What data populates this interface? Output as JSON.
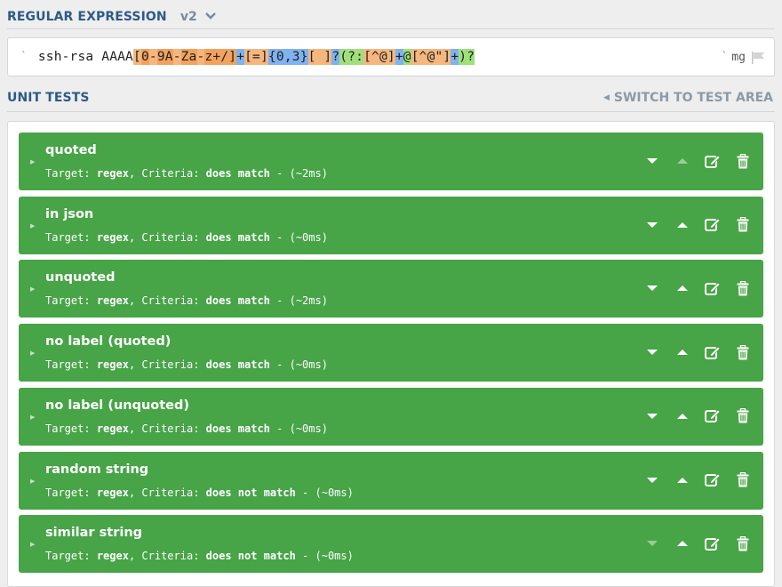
{
  "regex_section": {
    "title": "REGULAR EXPRESSION",
    "version": "v2",
    "open_delimiter": "`",
    "close_delimiter": "`",
    "flags": "mg",
    "tokens": [
      {
        "text": "ssh-rsa AAAA",
        "kind": "plain"
      },
      {
        "text": "[",
        "kind": "set"
      },
      {
        "text": "0",
        "kind": "setop"
      },
      {
        "text": "-",
        "kind": "set"
      },
      {
        "text": "9A",
        "kind": "setop"
      },
      {
        "text": "-",
        "kind": "set"
      },
      {
        "text": "Za",
        "kind": "setop"
      },
      {
        "text": "-",
        "kind": "set"
      },
      {
        "text": "z+/]",
        "kind": "setop"
      },
      {
        "text": "+",
        "kind": "quant"
      },
      {
        "text": "[=]",
        "kind": "set"
      },
      {
        "text": "{0,3}",
        "kind": "quant"
      },
      {
        "text": "[ ]",
        "kind": "set"
      },
      {
        "text": "?",
        "kind": "quant"
      },
      {
        "text": "(?:",
        "kind": "grp"
      },
      {
        "text": "[^@]",
        "kind": "set"
      },
      {
        "text": "+",
        "kind": "quant"
      },
      {
        "text": "@",
        "kind": "grp"
      },
      {
        "text": "[^@\"]",
        "kind": "set"
      },
      {
        "text": "+",
        "kind": "quant"
      },
      {
        "text": ")?",
        "kind": "grp"
      }
    ]
  },
  "tests_section": {
    "title": "UNIT TESTS",
    "switch_label": "SWITCH TO TEST AREA"
  },
  "tests": [
    {
      "name": "quoted",
      "target_label": "Target:",
      "target": "regex",
      "criteria_label": "Criteria:",
      "criteria": "does match",
      "time": "- (~2ms)",
      "down_enabled": true,
      "up_enabled": false
    },
    {
      "name": "in json",
      "target_label": "Target:",
      "target": "regex",
      "criteria_label": "Criteria:",
      "criteria": "does match",
      "time": "- (~0ms)",
      "down_enabled": true,
      "up_enabled": true
    },
    {
      "name": "unquoted",
      "target_label": "Target:",
      "target": "regex",
      "criteria_label": "Criteria:",
      "criteria": "does match",
      "time": "- (~2ms)",
      "down_enabled": true,
      "up_enabled": true
    },
    {
      "name": "no label (quoted)",
      "target_label": "Target:",
      "target": "regex",
      "criteria_label": "Criteria:",
      "criteria": "does match",
      "time": "- (~0ms)",
      "down_enabled": true,
      "up_enabled": true
    },
    {
      "name": "no label (unquoted)",
      "target_label": "Target:",
      "target": "regex",
      "criteria_label": "Criteria:",
      "criteria": "does match",
      "time": "- (~0ms)",
      "down_enabled": true,
      "up_enabled": true
    },
    {
      "name": "random string",
      "target_label": "Target:",
      "target": "regex",
      "criteria_label": "Criteria:",
      "criteria": "does not match",
      "time": "- (~0ms)",
      "down_enabled": true,
      "up_enabled": true
    },
    {
      "name": "similar string",
      "target_label": "Target:",
      "target": "regex",
      "criteria_label": "Criteria:",
      "criteria": "does not match",
      "time": "- (~0ms)",
      "down_enabled": false,
      "up_enabled": true
    }
  ],
  "icons": {
    "header_chevron": "chevron-down-icon",
    "switch": "caret-left-icon",
    "flag": "flag-icon",
    "row_toggle": "caret-right-icon",
    "move_down": "move-down-icon",
    "move_up": "move-up-icon",
    "edit": "edit-icon",
    "delete": "trash-icon"
  },
  "colors": {
    "header_text": "#2d5a87",
    "test_pass": "#47a447",
    "set_token": "#f5b77d",
    "quant_token": "#7fb2f0",
    "group_token": "#9fe07c"
  }
}
